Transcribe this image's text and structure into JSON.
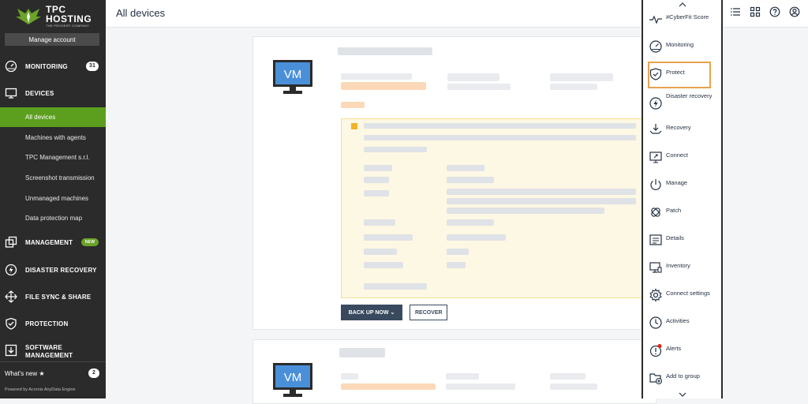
{
  "sidebar": {
    "logo": {
      "line1": "TPC",
      "line2": "HOSTING",
      "tagline": "THE PROSERT COMPANY"
    },
    "manage_account": "Manage account",
    "nav": {
      "monitoring": {
        "label": "MONITORING",
        "badge": "31"
      },
      "devices": {
        "label": "DEVICES"
      },
      "management": {
        "label": "MANAGEMENT",
        "badge": "NEW"
      },
      "disaster_recovery": {
        "label": "DISASTER RECOVERY"
      },
      "file_sync": {
        "label": "FILE SYNC & SHARE"
      },
      "protection": {
        "label": "PROTECTION"
      },
      "software_management": {
        "label": "SOFTWARE MANAGEMENT"
      }
    },
    "device_sub_items": [
      "All devices",
      "Machines with agents",
      "TPC Management s.r.l.",
      "Screenshot transmission",
      "Unmanaged machines",
      "Data protection map"
    ],
    "whats_new": {
      "label": "What's new",
      "badge": "2"
    },
    "powered_by": "Powered by Acronis AnyData Engine"
  },
  "header": {
    "title": "All devices"
  },
  "cards": [
    {
      "vm_label": "VM",
      "backup_label": "BACK UP NOW",
      "recover_label": "RECOVER"
    },
    {
      "vm_label": "VM"
    }
  ],
  "actions": [
    {
      "label": "#CyberFit Score",
      "icon": "pulse-icon"
    },
    {
      "label": "Monitoring",
      "icon": "gauge-icon"
    },
    {
      "label": "Protect",
      "icon": "shield-check-icon"
    },
    {
      "label": "Disaster recovery",
      "icon": "bolt-icon"
    },
    {
      "label": "Recovery",
      "icon": "recovery-icon"
    },
    {
      "label": "Connect",
      "icon": "monitor-connect-icon"
    },
    {
      "label": "Manage",
      "icon": "power-icon"
    },
    {
      "label": "Patch",
      "icon": "patch-icon"
    },
    {
      "label": "Details",
      "icon": "details-icon"
    },
    {
      "label": "Inventory",
      "icon": "inventory-icon"
    },
    {
      "label": "Connect settings",
      "icon": "gear-icon"
    },
    {
      "label": "Activities",
      "icon": "clock-icon"
    },
    {
      "label": "Alerts",
      "icon": "alert-icon"
    },
    {
      "label": "Add to group",
      "icon": "folder-plus-icon"
    }
  ],
  "colors": {
    "sidebar_bg": "#2b2b2b",
    "active_green": "#5c9f1e",
    "highlight_border": "#e8a250",
    "button_dark": "#394a5f"
  }
}
